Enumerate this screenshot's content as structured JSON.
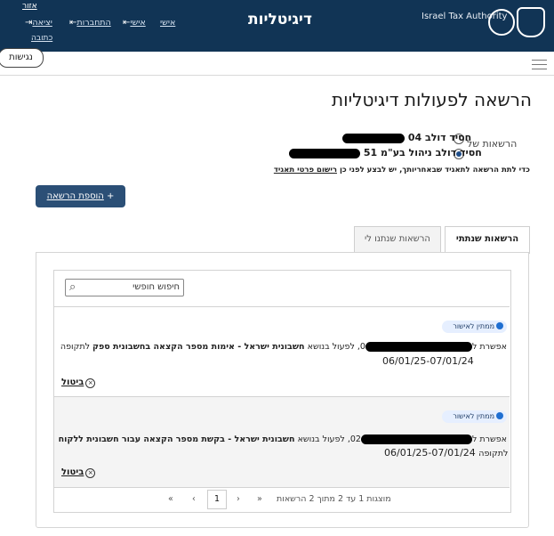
{
  "header": {
    "title": "דיגיטליות",
    "org": "Israel Tax Authority",
    "nav": {
      "logout": "יציאה",
      "reg": "התחברות",
      "personal": "אישי",
      "top": "אזור",
      "sub": "כתובה"
    }
  },
  "access_label": "נגישות",
  "page": {
    "title": "הרשאה לפעולות דיגיטליות",
    "permissions_of": "הרשאות של",
    "options": [
      {
        "prefix": "04",
        "name": "חסיד דולב"
      },
      {
        "prefix": "51",
        "name": "חסיד דולב ניהול בע\"מ"
      }
    ],
    "note": "כדי לתת הרשאה לתאגיד שבאחריותך, יש לבצע לפני כן",
    "note_link": "רישום פרטי תאגיד",
    "add_button": "הוספת הרשאה"
  },
  "tabs": {
    "active": "הרשאות שנתתי",
    "inactive": "הרשאות שנתנו לי"
  },
  "search": {
    "placeholder": "חיפוש חופשי"
  },
  "rows": [
    {
      "status": "ממתין לאישור",
      "text_a": "אפשרת ל",
      "text_b": "0, לפעול בנושא",
      "subject": "חשבונית ישראל - אימות מספר הקצאה בחשבונית ספק",
      "text_c": "לתקופה",
      "period": "06/01/25-07/01/24",
      "cancel": "ביטול"
    },
    {
      "status": "ממתין לאישור",
      "text_a": "אפשרת ל",
      "text_b": "02, לפעול בנושא",
      "subject": "חשבונית ישראל - בקשת מספר הקצאה עבור חשבונית ללקוח",
      "text_c": "לתקופה",
      "period": "06/01/25-07/01/24",
      "cancel": "ביטול"
    }
  ],
  "pager": {
    "summary": "מוצגות 1 עד 2 מתוך 2 הרשאות",
    "page": "1"
  }
}
